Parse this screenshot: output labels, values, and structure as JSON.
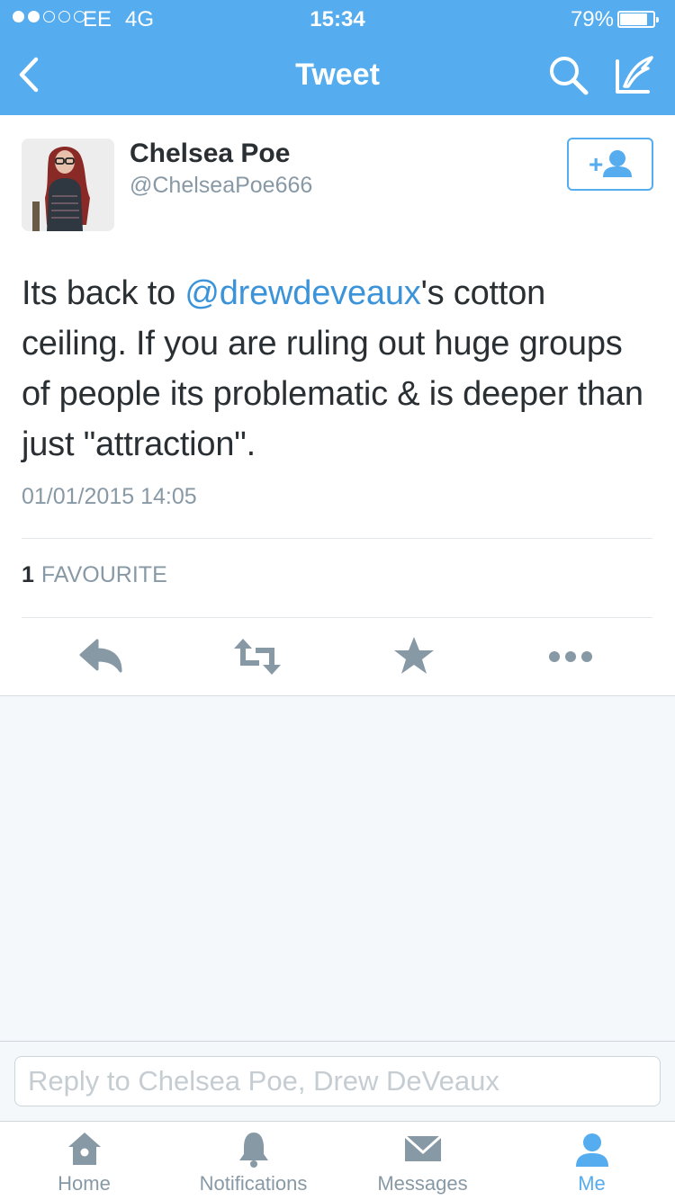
{
  "status_bar": {
    "carrier": "EE",
    "network": "4G",
    "time": "15:34",
    "battery": "79%",
    "signal_bars_filled": 2,
    "signal_bars_total": 5
  },
  "header": {
    "title": "Tweet",
    "back_icon": "chevron-left-icon",
    "search_icon": "search-icon",
    "compose_icon": "compose-icon",
    "color": "#55acee"
  },
  "tweet": {
    "author_name": "Chelsea Poe",
    "author_handle": "@ChelseaPoe666",
    "text_before": "Its back to ",
    "mention": "@drewdeveaux",
    "text_after": "'s cotton ceiling. If you are ruling out huge groups of people its problematic & is deeper than just \"attraction\".",
    "timestamp": "01/01/2015 14:05",
    "favourite_count": "1",
    "favourite_label": "FAVOURITE",
    "follow_icon": "add-user-icon",
    "actions": [
      {
        "name": "reply",
        "icon": "reply-icon"
      },
      {
        "name": "retweet",
        "icon": "retweet-icon"
      },
      {
        "name": "favorite",
        "icon": "star-icon"
      },
      {
        "name": "more",
        "icon": "more-icon"
      }
    ]
  },
  "reply": {
    "placeholder": "Reply to Chelsea Poe, Drew DeVeaux"
  },
  "tabs": [
    {
      "label": "Home",
      "icon": "home-icon",
      "active": false
    },
    {
      "label": "Notifications",
      "icon": "bell-icon",
      "active": false
    },
    {
      "label": "Messages",
      "icon": "envelope-icon",
      "active": false
    },
    {
      "label": "Me",
      "icon": "person-icon",
      "active": true
    }
  ],
  "colors": {
    "accent": "#55acee",
    "link": "#3b94d9",
    "icon_gray": "#8899a6"
  }
}
